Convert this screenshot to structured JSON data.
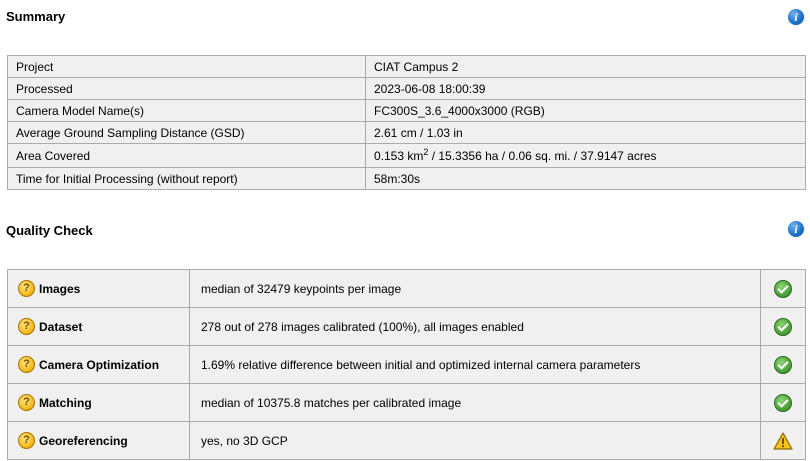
{
  "summary": {
    "title": "Summary",
    "rows": [
      {
        "key": "Project",
        "value": "CIAT Campus 2"
      },
      {
        "key": "Processed",
        "value": "2023-06-08 18:00:39"
      },
      {
        "key": "Camera Model Name(s)",
        "value": "FC300S_3.6_4000x3000 (RGB)"
      },
      {
        "key": "Average Ground Sampling Distance (GSD)",
        "value": "2.61 cm / 1.03 in"
      },
      {
        "key": "Area Covered",
        "value_pre": "0.153 km",
        "value_sup": "2",
        "value_post": " / 15.3356 ha / 0.06 sq. mi. / 37.9147 acres"
      },
      {
        "key": "Time for Initial Processing (without report)",
        "value": "58m:30s"
      }
    ]
  },
  "quality_check": {
    "title": "Quality Check",
    "rows": [
      {
        "name": "Images",
        "description": "median of 32479 keypoints per image",
        "status": "ok"
      },
      {
        "name": "Dataset",
        "description": "278 out of 278 images calibrated (100%), all images enabled",
        "status": "ok"
      },
      {
        "name": "Camera Optimization",
        "description": "1.69% relative difference between initial and optimized internal camera parameters",
        "status": "ok"
      },
      {
        "name": "Matching",
        "description": "median of 10375.8 matches per calibrated image",
        "status": "ok"
      },
      {
        "name": "Georeferencing",
        "description": "yes, no 3D GCP",
        "status": "warning"
      }
    ]
  },
  "icons": {
    "info": "info-icon",
    "help": "question-icon",
    "ok": "check-icon",
    "warning": "warning-icon"
  },
  "colors": {
    "info_blue": "#1f73c9",
    "ok_green": "#4ea33a",
    "warning_yellow": "#f3c21c",
    "help_orange": "#f3b81c"
  }
}
